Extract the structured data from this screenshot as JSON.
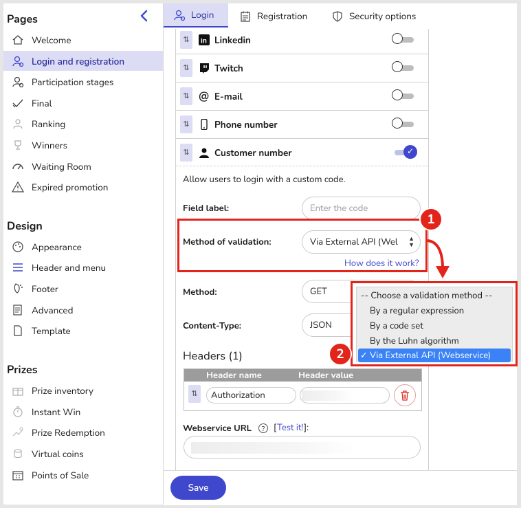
{
  "sidebar": {
    "sections": [
      {
        "title": "Pages",
        "items": [
          {
            "label": "Welcome",
            "icon": "home-icon"
          },
          {
            "label": "Login and registration",
            "icon": "user-login-icon",
            "active": true
          },
          {
            "label": "Participation stages",
            "icon": "user-stages-icon"
          },
          {
            "label": "Final",
            "icon": "check-icon"
          },
          {
            "label": "Ranking",
            "icon": "ranking-icon"
          },
          {
            "label": "Winners",
            "icon": "trophy-icon"
          },
          {
            "label": "Waiting Room",
            "icon": "gauge-icon"
          },
          {
            "label": "Expired promotion",
            "icon": "warning-icon"
          }
        ]
      },
      {
        "title": "Design",
        "items": [
          {
            "label": "Appearance",
            "icon": "palette-icon"
          },
          {
            "label": "Header and menu",
            "icon": "menu-icon"
          },
          {
            "label": "Footer",
            "icon": "footer-icon"
          },
          {
            "label": "Advanced",
            "icon": "code-icon"
          },
          {
            "label": "Template",
            "icon": "template-icon"
          }
        ]
      },
      {
        "title": "Prizes",
        "items": [
          {
            "label": "Prize inventory",
            "icon": "gift-icon"
          },
          {
            "label": "Instant Win",
            "icon": "instant-win-icon"
          },
          {
            "label": "Prize Redemption",
            "icon": "redemption-icon"
          },
          {
            "label": "Virtual coins",
            "icon": "coins-icon"
          },
          {
            "label": "Points of Sale",
            "icon": "store-icon"
          }
        ]
      }
    ]
  },
  "tabs": [
    {
      "label": "Login",
      "icon": "user-login-icon",
      "active": true
    },
    {
      "label": "Registration",
      "icon": "form-icon"
    },
    {
      "label": "Security options",
      "icon": "shield-icon"
    }
  ],
  "login_methods": [
    {
      "label": "Linkedin",
      "icon": "linkedin-icon",
      "enabled": false
    },
    {
      "label": "Twitch",
      "icon": "twitch-icon",
      "enabled": false
    },
    {
      "label": "E-mail",
      "icon": "at-icon",
      "enabled": false
    },
    {
      "label": "Phone number",
      "icon": "phone-icon",
      "enabled": false
    },
    {
      "label": "Customer number",
      "icon": "person-icon",
      "enabled": true
    }
  ],
  "custom": {
    "description": "Allow users to login with a custom code.",
    "field_label_label": "Field label:",
    "field_label_placeholder": "Enter the code",
    "method_validation_label": "Method of validation:",
    "method_validation_value": "Via External API (Wel",
    "how_link": "How does it work?",
    "method_label": "Method:",
    "method_value": "GET",
    "content_type_label": "Content-Type:",
    "content_type_value": "JSON",
    "headers_title": "Headers (1)",
    "header_name_col": "Header name",
    "header_value_col": "Header value",
    "header_name_value": "Authorization",
    "webservice_label": "Webservice URL",
    "test_open": "[",
    "test_link": "Test it!",
    "test_close": "]:"
  },
  "dropdown": {
    "options": [
      "-- Choose a validation method --",
      "By a regular expression",
      "By a code set",
      "By the Luhn algorithm",
      "Via External API (Webservice)"
    ],
    "selected_index": 4,
    "check": "✓"
  },
  "annotations": {
    "step1": "1",
    "step2": "2"
  },
  "save_label": "Save",
  "colors": {
    "accent": "#3f47cc",
    "active_bg": "#dcdcf5",
    "annotation": "#e3241b",
    "dropdown_selected": "#3b82f6"
  }
}
